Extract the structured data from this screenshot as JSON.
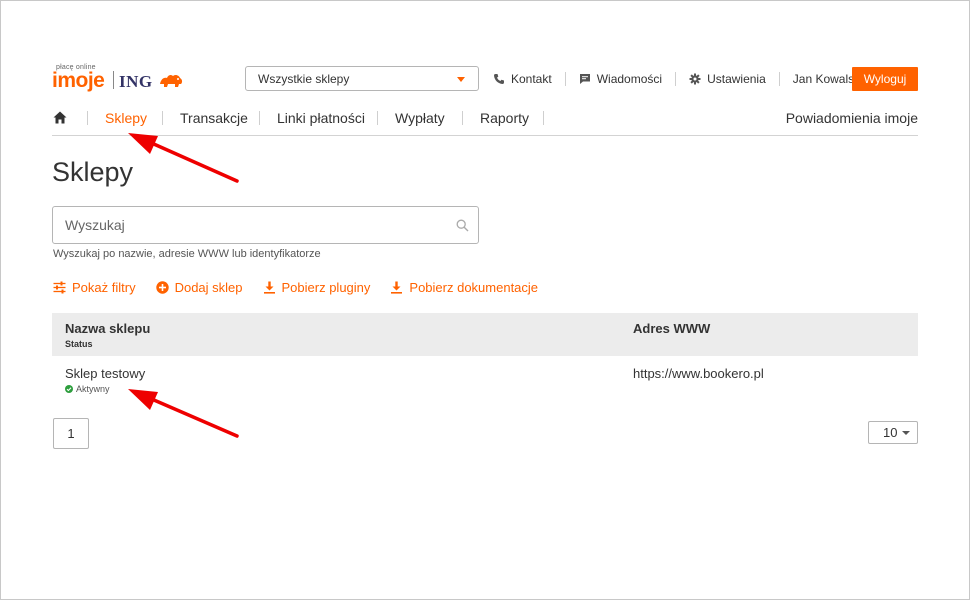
{
  "logo": {
    "small_text": "płacę online",
    "brand": "imoje",
    "bank": "ING"
  },
  "header": {
    "store_select": "Wszystkie sklepy",
    "links": [
      {
        "label": "Kontakt",
        "icon": "phone-icon"
      },
      {
        "label": "Wiadomości",
        "icon": "message-icon"
      },
      {
        "label": "Ustawienia",
        "icon": "gear-icon"
      }
    ],
    "user_name": "Jan Kowalski",
    "logout_label": "Wyloguj"
  },
  "nav": {
    "home_icon": "home-icon",
    "items": [
      {
        "label": "Sklepy",
        "active": true
      },
      {
        "label": "Transakcje",
        "active": false
      },
      {
        "label": "Linki płatności",
        "active": false
      },
      {
        "label": "Wypłaty",
        "active": false
      },
      {
        "label": "Raporty",
        "active": false
      }
    ],
    "right_label": "Powiadomienia imoje"
  },
  "page": {
    "title": "Sklepy",
    "search_placeholder": "Wyszukaj",
    "search_hint": "Wyszukaj po nazwie, adresie WWW lub identyfikatorze"
  },
  "actions": [
    {
      "label": "Pokaż filtry",
      "icon": "filter-icon"
    },
    {
      "label": "Dodaj sklep",
      "icon": "add-circle-icon"
    },
    {
      "label": "Pobierz pluginy",
      "icon": "download-icon"
    },
    {
      "label": "Pobierz dokumentacje",
      "icon": "download-icon"
    }
  ],
  "table": {
    "columns": {
      "name": "Nazwa sklepu",
      "status": "Status",
      "www": "Adres WWW"
    },
    "rows": [
      {
        "name": "Sklep testowy",
        "status": "Aktywny",
        "www": "https://www.bookero.pl"
      }
    ]
  },
  "pagination": {
    "current_page": "1",
    "per_page": "10"
  },
  "colors": {
    "accent": "#ff6200",
    "annotation": "#ee0000",
    "status_active": "#2e9e3e"
  }
}
